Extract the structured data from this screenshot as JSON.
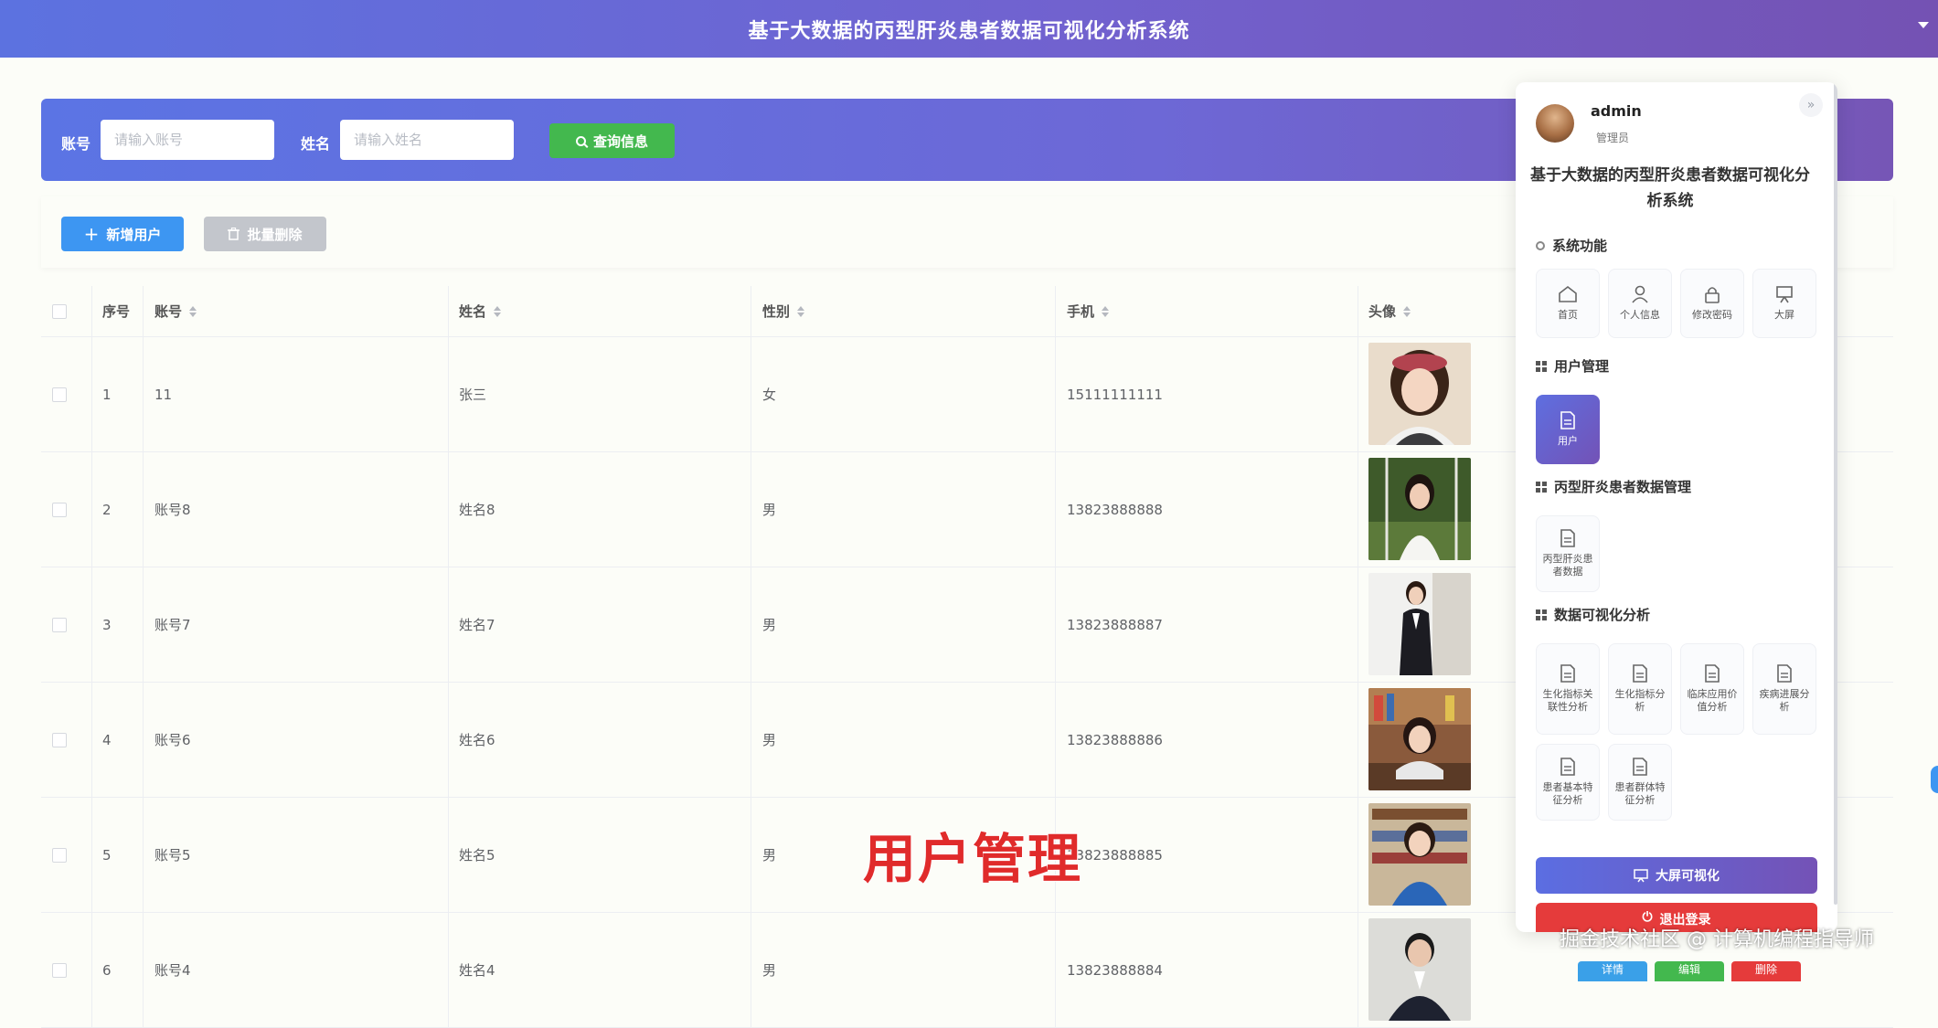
{
  "header": {
    "title": "基于大数据的丙型肝炎患者数据可视化分析系统"
  },
  "search": {
    "account_label": "账号",
    "account_placeholder": "请输入账号",
    "name_label": "姓名",
    "name_placeholder": "请输入姓名",
    "query_button": "查询信息"
  },
  "toolbar": {
    "add_button": "新增用户",
    "batch_delete_button": "批量删除"
  },
  "table": {
    "columns": [
      "序号",
      "账号",
      "姓名",
      "性别",
      "手机",
      "头像"
    ],
    "rows": [
      {
        "index": "1",
        "account": "11",
        "name": "张三",
        "gender": "女",
        "phone": "15111111111"
      },
      {
        "index": "2",
        "account": "账号8",
        "name": "姓名8",
        "gender": "男",
        "phone": "13823888888"
      },
      {
        "index": "3",
        "account": "账号7",
        "name": "姓名7",
        "gender": "男",
        "phone": "13823888887"
      },
      {
        "index": "4",
        "account": "账号6",
        "name": "姓名6",
        "gender": "男",
        "phone": "13823888886"
      },
      {
        "index": "5",
        "account": "账号5",
        "name": "姓名5",
        "gender": "男",
        "phone": "13823888885"
      },
      {
        "index": "6",
        "account": "账号4",
        "name": "姓名4",
        "gender": "男",
        "phone": "13823888884"
      }
    ],
    "row_actions": [
      "详情",
      "编辑",
      "删除"
    ]
  },
  "panel": {
    "user_name": "admin",
    "user_role": "管理员",
    "system_title": "基于大数据的丙型肝炎患者数据可视化分析系统",
    "sections": [
      {
        "title": "系统功能",
        "items": [
          "首页",
          "个人信息",
          "修改密码",
          "大屏"
        ]
      },
      {
        "title": "用户管理",
        "items": [
          "用户"
        ]
      },
      {
        "title": "丙型肝炎患者数据管理",
        "items": [
          "丙型肝炎患者数据"
        ]
      },
      {
        "title": "数据可视化分析",
        "items": [
          "生化指标关联性分析",
          "生化指标分析",
          "临床应用价值分析",
          "疾病进展分析",
          "患者基本特征分析",
          "患者群体特征分析"
        ]
      }
    ],
    "big_screen_button": "大屏可视化",
    "logout_button": "退出登录"
  },
  "overlay": {
    "caption": "用户管理",
    "watermark": "掘金技术社区 @ 计算机编程指导师"
  },
  "colors": {
    "accent": "#5c72e0",
    "brand_end": "#7452b3",
    "success": "#43b84e",
    "primary": "#3d96f2",
    "danger": "#e53b3b"
  }
}
